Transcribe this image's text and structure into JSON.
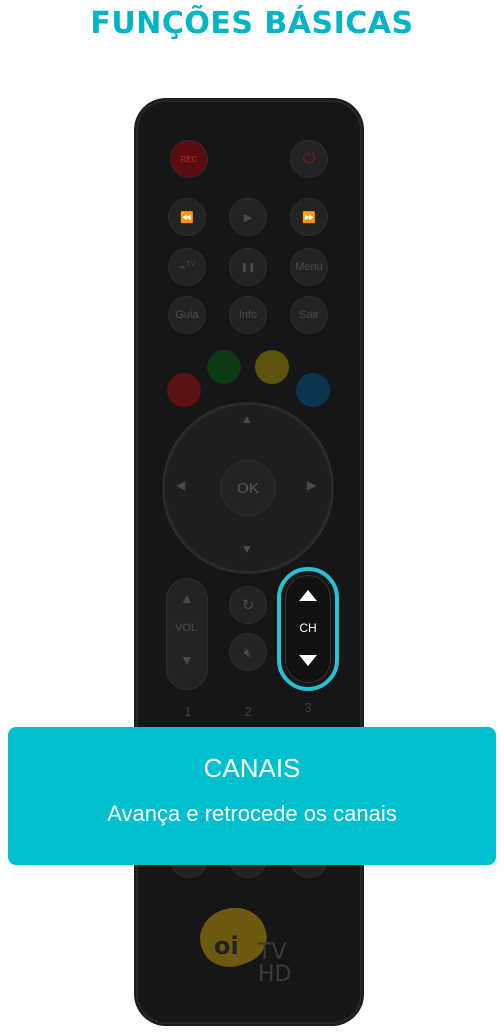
{
  "header": {
    "title": "FUNÇÕES BÁSICAS"
  },
  "remote": {
    "rec_label": "REC",
    "power_icon": "power-icon",
    "media": [
      "⏪",
      "▶",
      "⏩"
    ],
    "row2": {
      "tv_label": "TV",
      "pause": "❚❚",
      "menu": "Menu"
    },
    "row3": {
      "guia": "Guia",
      "info": "Info",
      "sair": "Sair"
    },
    "colors": {
      "red": "#a8171e",
      "green": "#0f6b22",
      "yellow": "#b0a10e",
      "blue": "#0b5f8f"
    },
    "ok_label": "OK",
    "vol_label": "VOL",
    "ch_label": "CH",
    "numbers": [
      "1",
      "2",
      "3"
    ]
  },
  "callout": {
    "title": "CANAIS",
    "text": "Avança e retrocede os canais",
    "color": "#00bfce"
  },
  "logo": {
    "brand": "oi",
    "tv": "TV",
    "hd": "HD"
  }
}
